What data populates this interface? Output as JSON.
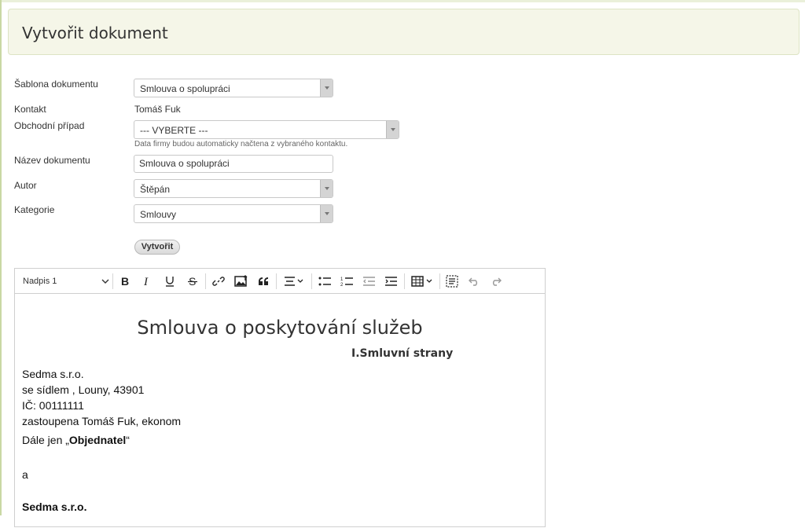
{
  "header": {
    "title": "Vytvořit dokument"
  },
  "form": {
    "template": {
      "label": "Šablona dokumentu",
      "value": "Smlouva o spolupráci"
    },
    "contact": {
      "label": "Kontakt",
      "value": "Tomáš Fuk"
    },
    "business_case": {
      "label": "Obchodní případ",
      "value": "--- VYBERTE ---",
      "hint": "Data firmy budou automaticky načtena z vybraného kontaktu."
    },
    "document_name": {
      "label": "Název dokumentu",
      "value": "Smlouva o spolupráci"
    },
    "author": {
      "label": "Autor",
      "value": "Štěpán"
    },
    "category": {
      "label": "Kategorie",
      "value": "Smlouvy"
    },
    "submit_label": "Vytvořit"
  },
  "editor": {
    "toolbar": {
      "heading_value": "Nadpis 1",
      "icons": [
        "bold-icon",
        "italic-icon",
        "underline-icon",
        "strikethrough-icon",
        "link-icon",
        "image-upload-icon",
        "blockquote-icon",
        "align-icon",
        "bulleted-list-icon",
        "numbered-list-icon",
        "outdent-icon",
        "indent-icon",
        "table-icon",
        "source-icon",
        "undo-icon",
        "redo-icon"
      ]
    },
    "content": {
      "title": "Smlouva o poskytování služeb",
      "subtitle": "I.Smluvní strany",
      "company": "Sedma s.r.o.",
      "address": "se sídlem , Louny, 43901",
      "ic": "IČ: 00111111",
      "represented": "zastoupena Tomáš Fuk, ekonom",
      "referred_prefix": "Dále jen „",
      "referred_bold": "Objednatel",
      "referred_suffix": "“",
      "conjunction": "a",
      "company2": "Sedma s.r.o."
    }
  }
}
